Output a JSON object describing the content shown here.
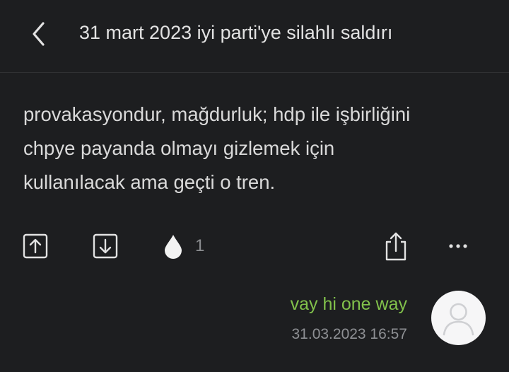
{
  "header": {
    "back_icon": "chevron-left-icon",
    "title": "31 mart 2023 iyi parti'ye silahlı saldırı"
  },
  "entry": {
    "lines": [
      "provakasyondur, mağdurluk; hdp ile işbirliğini",
      "chpye payanda olmayı gizlemek için",
      "kullanılacak ama geçti o tren."
    ]
  },
  "actions": {
    "upvote_icon": "arrow-up-box-icon",
    "downvote_icon": "arrow-down-box-icon",
    "favorite_icon": "drop-icon",
    "favorite_count": "1",
    "share_icon": "share-icon",
    "more_icon": "more-horizontal-icon"
  },
  "author": {
    "name": "vay hi one way",
    "date": "31.03.2023 16:57",
    "avatar_icon": "default-avatar-icon"
  },
  "colors": {
    "background": "#1d1e20",
    "author": "#81c14b",
    "muted": "#8e9094"
  }
}
